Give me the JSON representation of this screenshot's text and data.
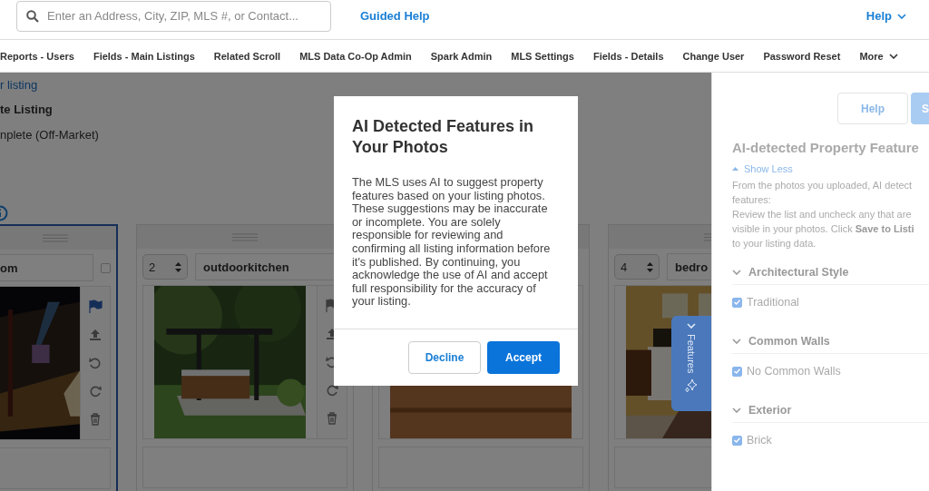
{
  "header": {
    "search": {
      "placeholder": "Enter an Address, City, ZIP, MLS #, or Contact..."
    },
    "guided_help": "Guided Help",
    "help_menu": "Help"
  },
  "nav": {
    "items": [
      "Reports - Users",
      "Fields - Main Listings",
      "Related Scroll",
      "MLS Data Co-Op Admin",
      "Spark Admin",
      "MLS Settings",
      "Fields - Details",
      "Change User",
      "Password Reset"
    ],
    "more": "More"
  },
  "page": {
    "back_link": "r listing",
    "heading": "te Listing",
    "status": "nplete (Off-Market)"
  },
  "cards": [
    {
      "selected": true,
      "name": "om",
      "checked": false,
      "flagged": true
    },
    {
      "selected": false,
      "number": "2",
      "name": "outdoorkitchen",
      "flagged": false
    },
    {
      "selected": false
    },
    {
      "selected": false,
      "number": "4",
      "name": "bedro"
    }
  ],
  "features_tab": {
    "label": "Features"
  },
  "dialog": {
    "title": "AI Detected Features in Your Photos",
    "body": "The MLS uses AI to suggest property features based on your listing photos. These suggestions may be inaccurate or incomplete. You are solely responsible for reviewing and confirming all listing information before it's published. By continuing, you acknowledge the use of AI and accept full responsibility for the accuracy of your listing.",
    "buttons": [
      {
        "label": "Decline",
        "kind": "secondary"
      },
      {
        "label": "Accept",
        "kind": "primary"
      }
    ]
  },
  "panel": {
    "buttons": [
      {
        "label": "Help",
        "kind": "secondary"
      },
      {
        "label": "S",
        "kind": "primary"
      }
    ],
    "title": "AI-detected Property Feature",
    "toggle": "Show Less",
    "paragraphs": [
      "From the photos you uploaded, AI detect\nfeatures:",
      "Review the list and uncheck any that are\nvisible in your photos. Click **Save to Listi**\nto your listing data."
    ],
    "sections": [
      {
        "title": "Architectural Style",
        "expanded": true,
        "items": [
          {
            "label": "Traditional",
            "checked": true
          }
        ]
      },
      {
        "title": "Common Walls",
        "expanded": true,
        "items": [
          {
            "label": "No Common Walls",
            "checked": true
          }
        ]
      },
      {
        "title": "Exterior",
        "expanded": true,
        "items": [
          {
            "label": "Brick",
            "checked": true
          }
        ]
      }
    ]
  }
}
